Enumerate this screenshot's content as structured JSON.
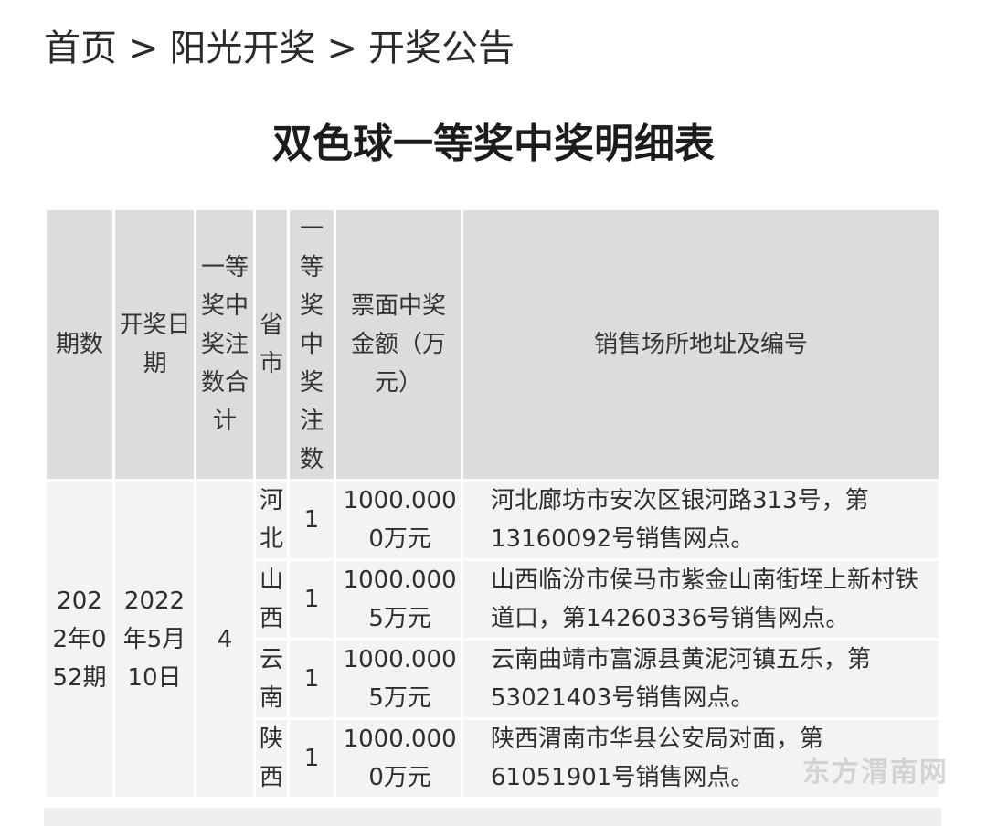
{
  "breadcrumb": {
    "items": [
      "首页",
      "阳光开奖",
      "开奖公告"
    ],
    "separator": ">"
  },
  "page_title": "双色球一等奖中奖明细表",
  "table": {
    "headers": {
      "period": "期数",
      "date": "开奖日期",
      "total": "一等奖中奖注数合计",
      "province": "省市",
      "count": "一等奖中奖注数",
      "amount": "票面中奖金额（万元）",
      "address": "销售场所地址及编号"
    },
    "group": {
      "period": "2022年052期",
      "date": "2022年5月10日",
      "total": "4"
    },
    "rows": [
      {
        "province": "河北",
        "count": "1",
        "amount": "1000.0000万元",
        "address": "河北廊坊市安次区银河路313号，第13160092号销售网点。"
      },
      {
        "province": "山西",
        "count": "1",
        "amount": "1000.0005万元",
        "address": "山西临汾市侯马市紫金山南街垤上新村铁道口，第14260336号销售网点。"
      },
      {
        "province": "云南",
        "count": "1",
        "amount": "1000.0005万元",
        "address": "云南曲靖市富源县黄泥河镇五乐，第53021403号销售网点。"
      },
      {
        "province": "陕西",
        "count": "1",
        "amount": "1000.0000万元",
        "address": "陕西渭南市华县公安局对面，第61051901号销售网点。"
      }
    ]
  },
  "watermark": {
    "text": "东方渭南网"
  }
}
